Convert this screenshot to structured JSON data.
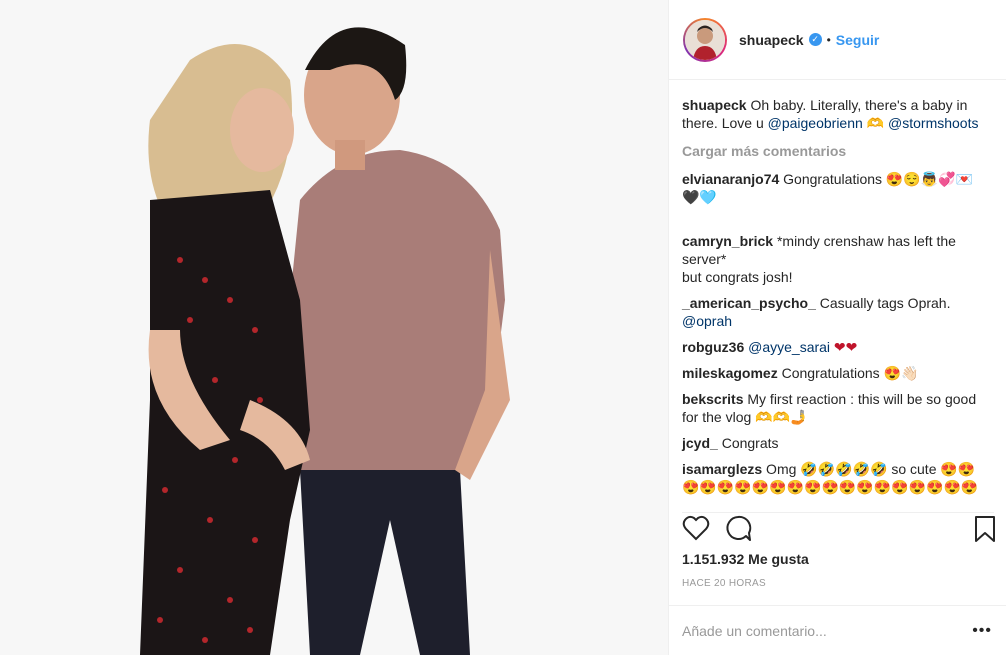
{
  "post": {
    "username": "shuapeck",
    "verified": "✓",
    "dot": "•",
    "follow_label": "Seguir"
  },
  "caption": {
    "username": "shuapeck",
    "text": " Oh baby. Literally, there's a baby in there. Love u ",
    "mention1": "@paigeobrienn",
    "glyph": " 🫶 ",
    "mention2": "@stormshoots"
  },
  "load_more": "Cargar más comentarios",
  "comments": [
    {
      "user": "elvianaranjo74",
      "text": " Gongratulations 😍😌👼💞💌🖤🩵"
    },
    {
      "user": "camryn_brick",
      "text": " *mindy crenshaw has left the server*\nbut congrats josh!"
    },
    {
      "user": "_american_psycho_",
      "text": " Casually tags Oprah. ",
      "mention": "@oprah"
    },
    {
      "user": "robguz36",
      "text": " ",
      "mention": "@ayye_sarai",
      "tail": " ❤❤"
    },
    {
      "user": "mileskagomez",
      "text": " Congratulations 😍👋🏻"
    },
    {
      "user": "bekscrits",
      "text": " My first reaction : this will be so good for the vlog 🫶🫶🤳"
    },
    {
      "user": "jcyd_",
      "text": " Congrats"
    },
    {
      "user": "isamarglezs",
      "text": " Omg 🤣🤣🤣🤣🤣  so cute 😍😍😍😍😍😍😍😍😍😍😍😍😍😍😍😍😍😍😍😍😍😍😍"
    }
  ],
  "likes": "1.151.932 Me gusta",
  "time": "HACE 20 HORAS",
  "add_comment_placeholder": "Añade un comentario...",
  "more_icon": "•••",
  "colors": {
    "link": "#3897f0",
    "mention": "#003569",
    "muted": "#999999"
  }
}
